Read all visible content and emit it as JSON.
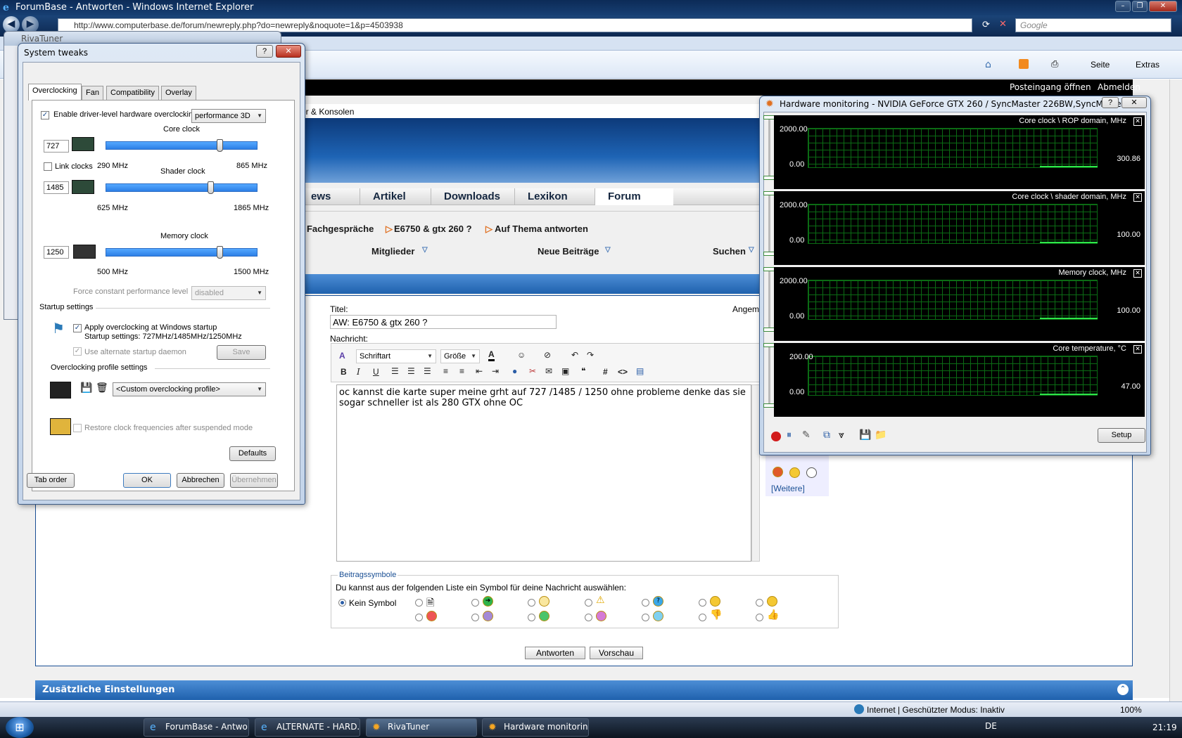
{
  "browser": {
    "title": "ForumBase - Antworten - Windows Internet Explorer",
    "url": "http://www.computerbase.de/forum/newreply.php?do=newreply&noquote=1&p=4503938",
    "search_placeholder": "Google",
    "cmd": {
      "seite": "Seite",
      "extras": "Extras"
    },
    "status": {
      "zone": "Internet | Geschützter Modus: Inaktiv",
      "zoom": "100%"
    }
  },
  "forum": {
    "top_links": {
      "inbox": "Posteingang öffnen",
      "logout": "Abmelden"
    },
    "category_fragment": "er & Konsolen",
    "nav": [
      "ews",
      "Artikel",
      "Downloads",
      "Lexikon",
      "Forum"
    ],
    "breadcrumb": {
      "part1": ": Fachgespräche",
      "part2": "E6750 & gtx 260 ?",
      "part3": "Auf Thema antworten"
    },
    "subnav": {
      "members": "Mitglieder",
      "new_posts": "Neue Beiträge",
      "search": "Suchen"
    },
    "form": {
      "title_label": "Titel:",
      "title_value": "AW: E6750 & gtx 260 ?",
      "angem": "Angem",
      "message_label": "Nachricht:",
      "font_select": "Schriftart",
      "size_select": "Größe",
      "message": "oc kannst die karte super meine grht auf 727 /1485 / 1250 ohne probleme denke das sie sogar schneller ist als 280 GTX ohne OC",
      "more_smilies": "[Weitere]"
    },
    "symbols": {
      "legend": "Beitragssymbole",
      "desc": "Du kannst aus der folgenden Liste ein Symbol für deine Nachricht auswählen:",
      "none": "Kein Symbol"
    },
    "buttons": {
      "reply": "Antworten",
      "preview": "Vorschau"
    },
    "extra_settings": "Zusätzliche Einstellungen"
  },
  "riva_bg": {
    "title": "RivaTuner"
  },
  "tweaks": {
    "title": "System tweaks",
    "tabs": [
      "Overclocking",
      "Fan",
      "Compatibility",
      "Overlay"
    ],
    "enable_label": "Enable driver-level hardware overclocking",
    "mode": "performance 3D",
    "link_clocks": "Link clocks",
    "core": {
      "label": "Core clock",
      "value": "727",
      "min": "290 MHz",
      "max": "865 MHz",
      "level": 0.75
    },
    "shader": {
      "label": "Shader clock",
      "value": "1485",
      "min": "625 MHz",
      "max": "1865 MHz",
      "level": 0.69
    },
    "memory": {
      "label": "Memory clock",
      "value": "1250",
      "min": "500 MHz",
      "max": "1500 MHz",
      "level": 0.75
    },
    "force_label": "Force constant performance level",
    "force_value": "disabled",
    "startup_header": "Startup settings",
    "apply_label": "Apply overclocking at Windows startup",
    "startup_values": "Startup settings: 727MHz/1485MHz/1250MHz",
    "alt_daemon": "Use alternate startup daemon",
    "save": "Save",
    "profile_header": "Overclocking profile settings",
    "profile_value": "<Custom overclocking profile>",
    "restore_label": "Restore clock frequencies after suspended mode",
    "defaults": "Defaults",
    "tab_order": "Tab order",
    "ok": "OK",
    "cancel": "Abbrechen",
    "apply": "Übernehmen"
  },
  "monitor": {
    "title": "Hardware monitoring - NVIDIA GeForce GTX 260 / SyncMaster 226BW,SyncMaster ...",
    "graphs": [
      {
        "name": "Core clock \\ ROP domain, MHz",
        "max": "2000.00",
        "min": "0.00",
        "current": "300.86"
      },
      {
        "name": "Core clock \\ shader domain, MHz",
        "max": "2000.00",
        "min": "0.00",
        "current": "100.00"
      },
      {
        "name": "Memory clock, MHz",
        "max": "2000.00",
        "min": "0.00",
        "current": "100.00"
      },
      {
        "name": "Core temperature, °C",
        "max": "200.00",
        "min": "0.00",
        "current": "47.00"
      }
    ],
    "setup": "Setup"
  },
  "taskbar": {
    "tasks": [
      "ForumBase - Antwo...",
      "ALTERNATE - HARD...",
      "RivaTuner",
      "Hardware monitorin..."
    ],
    "lang": "DE",
    "time": "21:19"
  }
}
